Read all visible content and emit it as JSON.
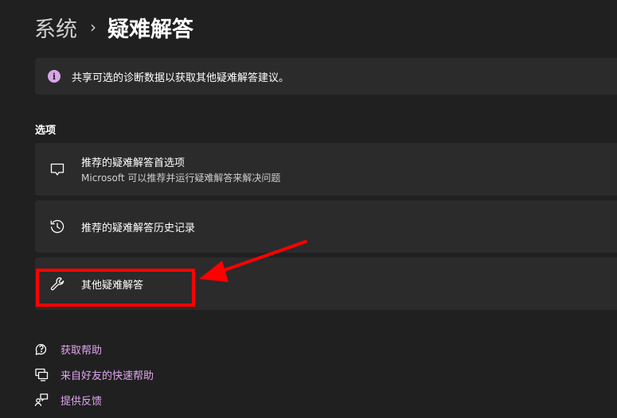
{
  "breadcrumb": {
    "parent": "系统",
    "separator": "›",
    "current": "疑难解答"
  },
  "banner": {
    "icon": "info-icon",
    "text": "共享可选的诊断数据以获取其他疑难解答建议。",
    "icon_color": "#d9a6e6"
  },
  "options": {
    "heading": "选项",
    "items": [
      {
        "icon": "chat-bubble-icon",
        "title": "推荐的疑难解答首选项",
        "subtitle": "Microsoft 可以推荐并运行疑难解答来解决问题"
      },
      {
        "icon": "history-icon",
        "title": "推荐的疑难解答历史记录"
      },
      {
        "icon": "wrench-icon",
        "title": "其他疑难解答"
      }
    ]
  },
  "links": [
    {
      "icon": "help-icon",
      "label": "获取帮助"
    },
    {
      "icon": "quick-assist-icon",
      "label": "来自好友的快速帮助"
    },
    {
      "icon": "feedback-icon",
      "label": "提供反馈"
    }
  ],
  "colors": {
    "background": "#202020",
    "card": "#2b2b2b",
    "link": "#e0a6f0",
    "annotation": "#ff0000"
  }
}
